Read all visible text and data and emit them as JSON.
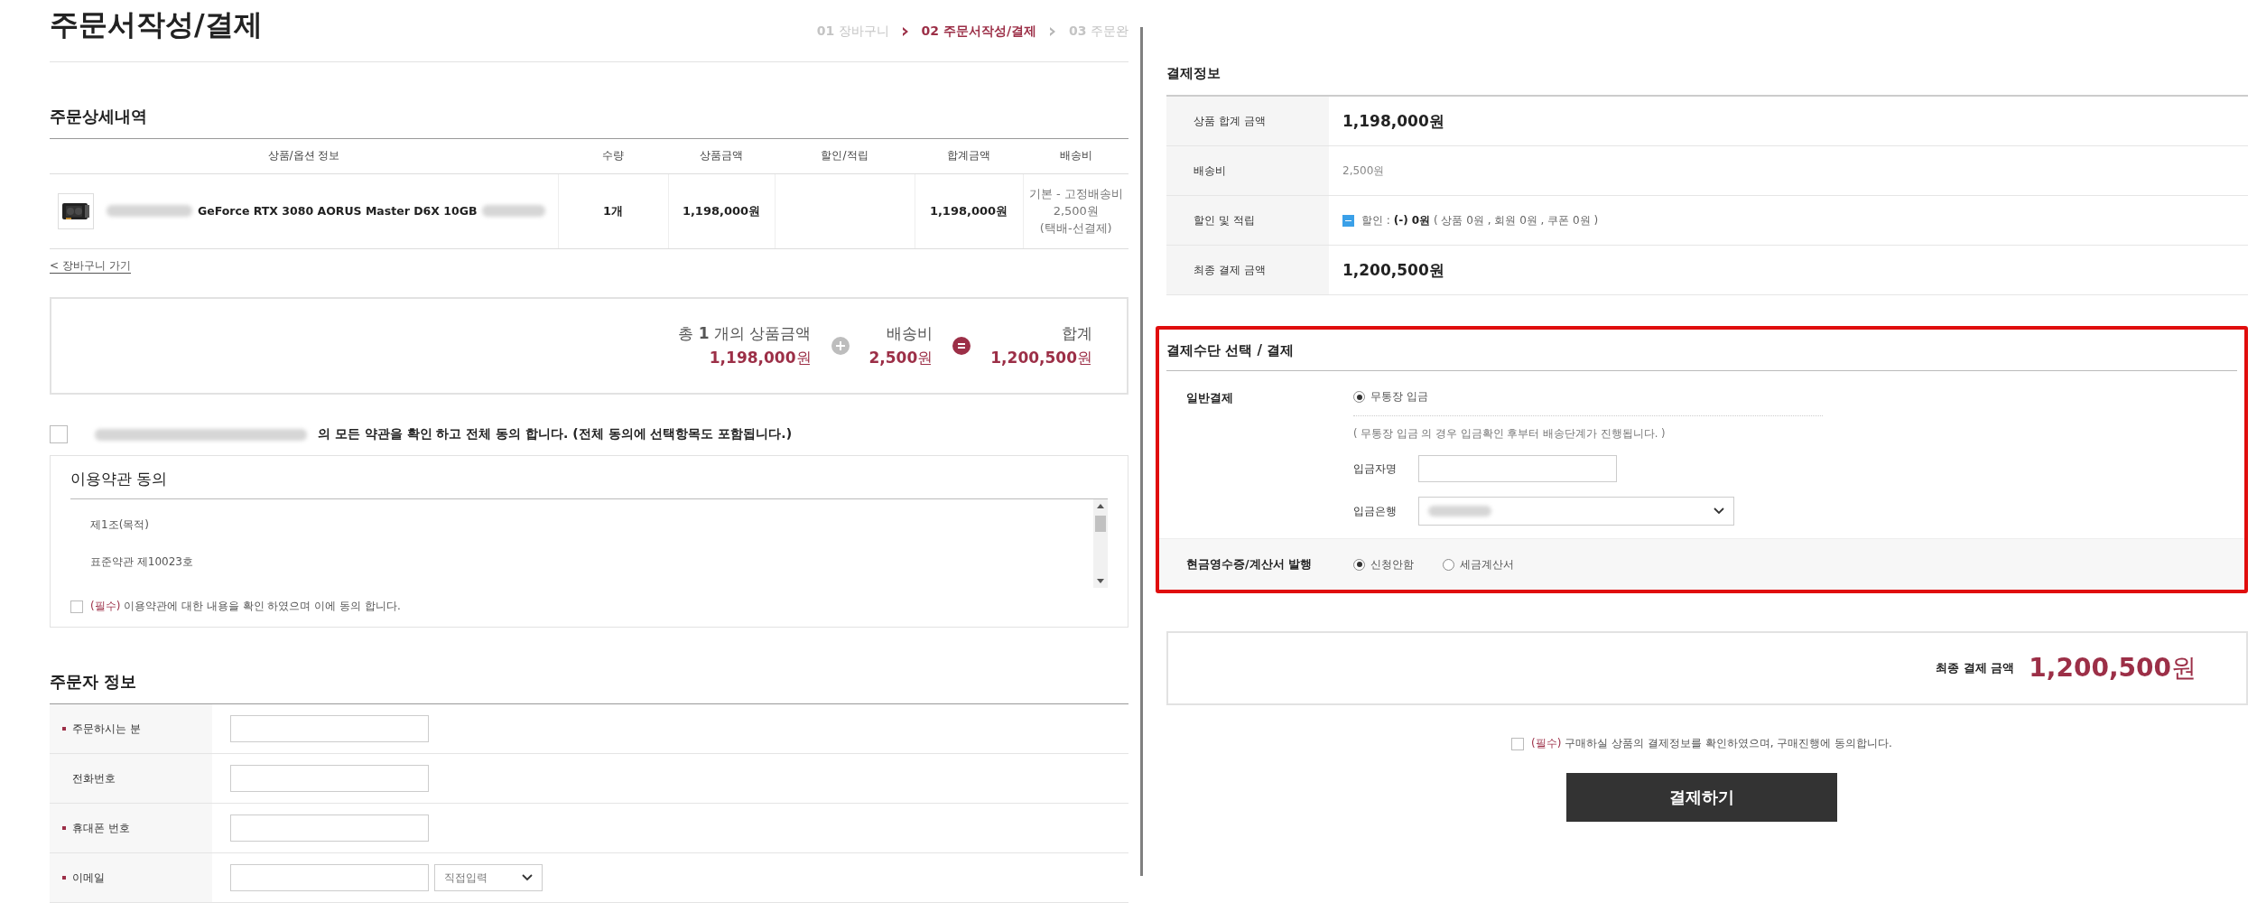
{
  "page_title": "주문서작성/결제",
  "steps": [
    {
      "number": "01",
      "label": "장바구니",
      "selected": false
    },
    {
      "number": "02",
      "label": "주문서작성/결제",
      "selected": true
    },
    {
      "number": "03",
      "label": "주문완",
      "selected": false
    }
  ],
  "order_details": {
    "title": "주문상세내역",
    "columns": [
      "상품/옵션 정보",
      "수량",
      "상품금액",
      "할인/적립",
      "합계금액",
      "배송비"
    ],
    "rows": [
      {
        "product": "GeForce RTX 3080 AORUS Master D6X 10GB",
        "quantity": "1개",
        "price": "1,198,000원",
        "total": "1,198,000원",
        "shipping": [
          "기본 - 고정배송비",
          "2,500원",
          "(택배-선결제)"
        ]
      }
    ]
  },
  "back_link": "< 장바구니 가기",
  "summary": {
    "items": [
      {
        "label": "총 **1** 개의 상품금액",
        "amount": "1,198,000",
        "unit": "원",
        "kind": "plus_term"
      },
      {
        "label": "배송비",
        "amount": "2,500",
        "unit": "원",
        "kind": "equals_term"
      },
      {
        "label": "합계",
        "amount": "1,200,500",
        "unit": "원",
        "kind": "total"
      }
    ]
  },
  "agree_all": {
    "checked": false,
    "text": "의 모든 약관을 확인 하고 전체 동의 합니다. (전체 동의에 선택항목도 포함됩니다.)"
  },
  "terms": {
    "title": "이용약관 동의",
    "lines": [
      "제1조(목적)",
      "표준약관 제10023호"
    ],
    "agree": {
      "checked": false,
      "tag": "(필수)",
      "text": "이용약관에 대한 내용을 확인 하였으며 이에 동의 합니다."
    }
  },
  "orderer": {
    "title": "주문자 정보",
    "fields": [
      {
        "label": "주문하시는 분",
        "required": true,
        "kind": "text"
      },
      {
        "label": "전화번호",
        "required": false,
        "kind": "text"
      },
      {
        "label": "휴대폰 번호",
        "required": true,
        "kind": "text"
      },
      {
        "label": "이메일",
        "required": true,
        "kind": "email",
        "select": "직접입력"
      }
    ]
  },
  "payment_info": {
    "title": "결제정보",
    "rows": [
      {
        "label": "상품 합계 금액",
        "kind": "large",
        "value": "1,198,000원"
      },
      {
        "label": "배송비",
        "kind": "plain",
        "value": "2,500원"
      },
      {
        "label": "할인 및 적립",
        "kind": "discount",
        "expanded": true,
        "value": "할인 : **(-) 0원** ( 상품 0원 , 회원 0원 , 쿠폰 0원 )"
      },
      {
        "label": "최종 결제 금액",
        "kind": "large",
        "value": "**1,200,500**원"
      }
    ]
  },
  "payment_method": {
    "highlighted": true,
    "title": "결제수단 선택 / 결제",
    "general": {
      "label": "일반결제",
      "options": [
        {
          "label": "무통장 입금",
          "selected": true
        }
      ],
      "note": "( 무통장 입금 의 경우 입금확인 후부터 배송단계가 진행됩니다. )",
      "fields": [
        {
          "label": "입금자명",
          "kind": "text"
        },
        {
          "label": "입금은행",
          "kind": "select"
        }
      ]
    },
    "receipt": {
      "label": "현금영수증/계산서 발행",
      "options": [
        {
          "label": "신청안함",
          "selected": true
        },
        {
          "label": "세금계산서",
          "selected": false
        }
      ]
    }
  },
  "final": {
    "label": "최종 결제 금액",
    "amount": "1,200,500",
    "unit": "원"
  },
  "purchase_agree": {
    "checked": false,
    "tag": "(필수)",
    "text": "구매하실 상품의 결제정보를 확인하였으며, 구매진행에 동의합니다."
  },
  "pay_button": "결제하기"
}
